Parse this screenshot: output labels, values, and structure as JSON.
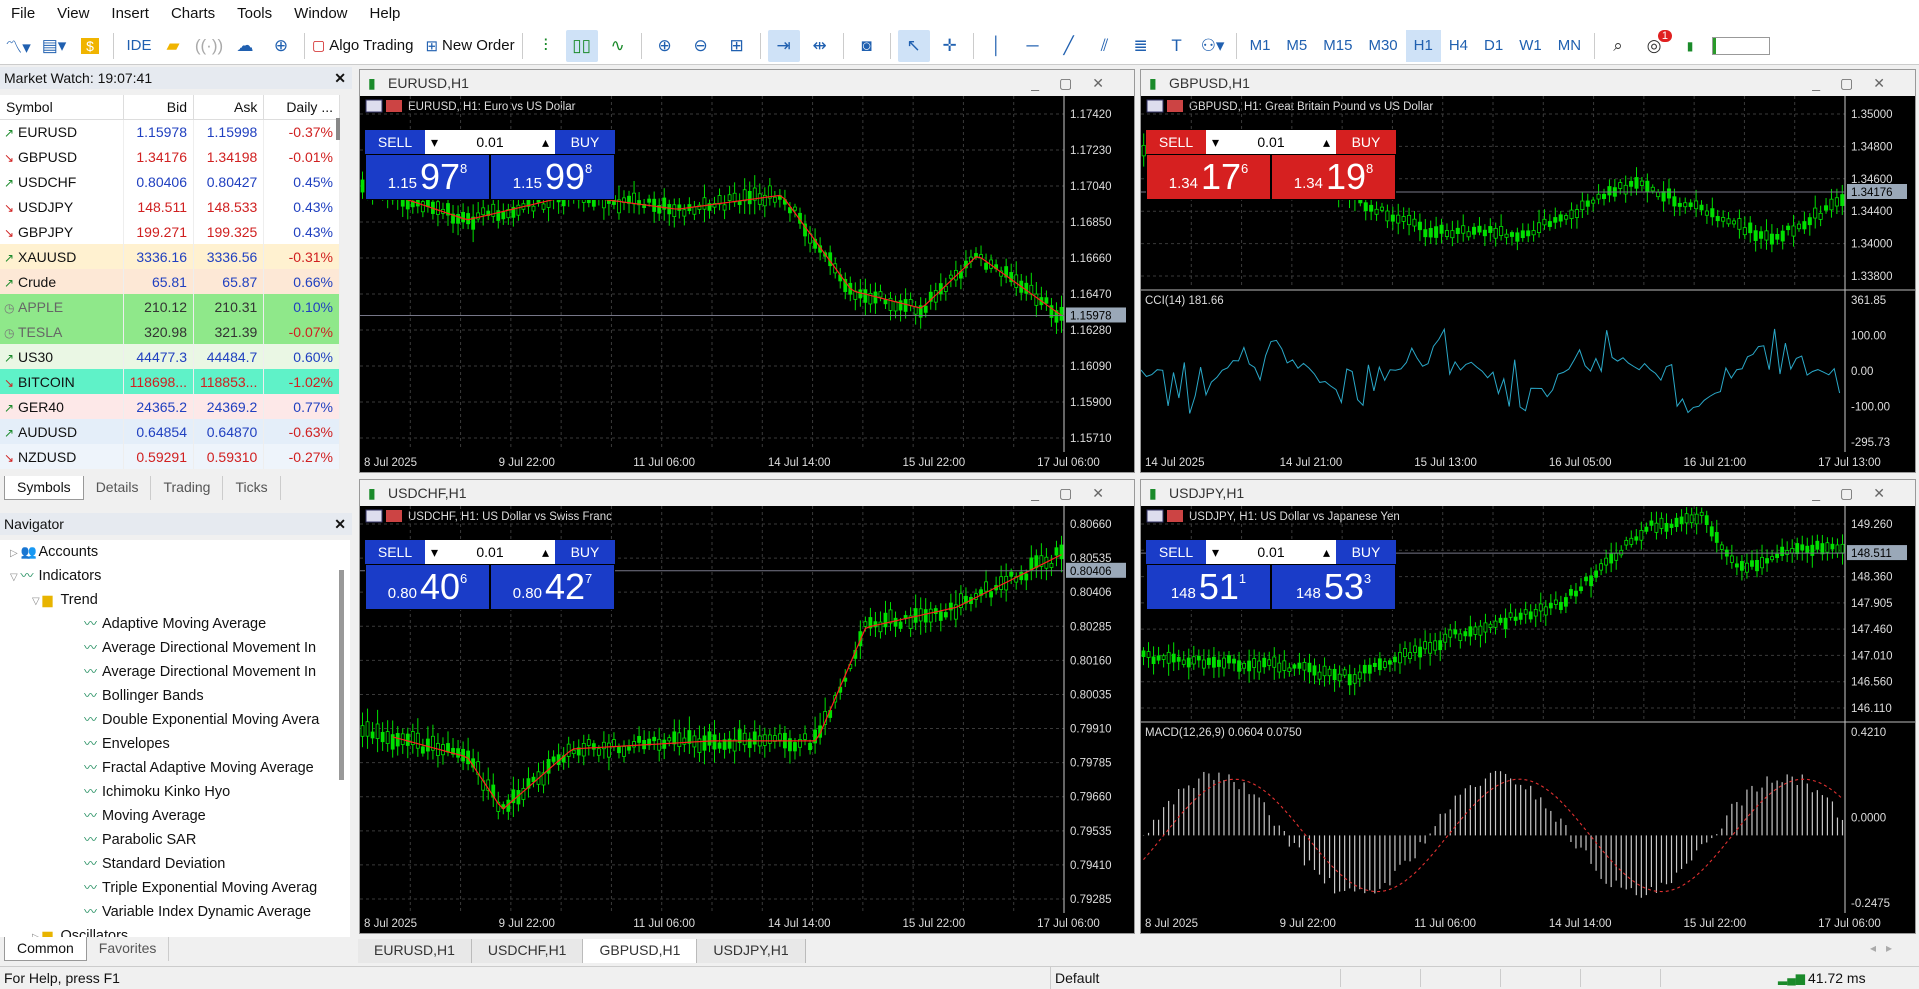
{
  "menu": [
    "File",
    "View",
    "Insert",
    "Charts",
    "Tools",
    "Window",
    "Help"
  ],
  "toolbar": {
    "ide": "IDE",
    "algo_trading": "Algo Trading",
    "new_order": "New Order",
    "timeframes": [
      "M1",
      "M5",
      "M15",
      "M30",
      "H1",
      "H4",
      "D1",
      "W1",
      "MN"
    ],
    "selected_timeframe": "H1",
    "notification_count": "1"
  },
  "market_watch": {
    "title": "Market Watch: 19:07:41",
    "columns": [
      "Symbol",
      "Bid",
      "Ask",
      "Daily ..."
    ],
    "rows": [
      {
        "symbol": "EURUSD",
        "bid": "1.15978",
        "ask": "1.15998",
        "daily": "-0.37%",
        "dir": "up",
        "bg": "#ffffff"
      },
      {
        "symbol": "GBPUSD",
        "bid": "1.34176",
        "ask": "1.34198",
        "daily": "-0.01%",
        "dir": "dn",
        "bg": "#ffffff"
      },
      {
        "symbol": "USDCHF",
        "bid": "0.80406",
        "ask": "0.80427",
        "daily": "0.45%",
        "dir": "up",
        "bg": "#ffffff"
      },
      {
        "symbol": "USDJPY",
        "bid": "148.511",
        "ask": "148.533",
        "daily": "0.43%",
        "dir": "dn",
        "bg": "#ffffff"
      },
      {
        "symbol": "GBPJPY",
        "bid": "199.271",
        "ask": "199.325",
        "daily": "0.43%",
        "dir": "dn",
        "bg": "#ffffff"
      },
      {
        "symbol": "XAUUSD",
        "bid": "3336.16",
        "ask": "3336.56",
        "daily": "-0.31%",
        "dir": "up",
        "bg": "#fff1d0"
      },
      {
        "symbol": "Crude",
        "bid": "65.81",
        "ask": "65.87",
        "daily": "0.66%",
        "dir": "up",
        "bg": "#fde8d6"
      },
      {
        "symbol": "APPLE",
        "bid": "210.12",
        "ask": "210.31",
        "daily": "0.10%",
        "dir": "clock",
        "bg": "#8fe88a"
      },
      {
        "symbol": "TESLA",
        "bid": "320.98",
        "ask": "321.39",
        "daily": "-0.07%",
        "dir": "clock",
        "bg": "#8fe88a"
      },
      {
        "symbol": "US30",
        "bid": "44477.3",
        "ask": "44484.7",
        "daily": "0.60%",
        "dir": "up",
        "bg": "#eaf7e4"
      },
      {
        "symbol": "BITCOIN",
        "bid": "118698...",
        "ask": "118853...",
        "daily": "-1.02%",
        "dir": "dn",
        "bg": "#5ff2c8"
      },
      {
        "symbol": "GER40",
        "bid": "24365.2",
        "ask": "24369.2",
        "daily": "0.77%",
        "dir": "up",
        "bg": "#fde8e8"
      },
      {
        "symbol": "AUDUSD",
        "bid": "0.64854",
        "ask": "0.64870",
        "daily": "-0.63%",
        "dir": "up",
        "bg": "#e4eef9"
      },
      {
        "symbol": "NZDUSD",
        "bid": "0.59291",
        "ask": "0.59310",
        "daily": "-0.27%",
        "dir": "dn",
        "bg": "#eef4fb"
      }
    ],
    "tabs": [
      "Symbols",
      "Details",
      "Trading",
      "Ticks"
    ],
    "active_tab": "Symbols"
  },
  "navigator": {
    "title": "Navigator",
    "accounts": "Accounts",
    "indicators": "Indicators",
    "trend": "Trend",
    "items": [
      "Adaptive Moving Average",
      "Average Directional Movement In",
      "Average Directional Movement In",
      "Bollinger Bands",
      "Double Exponential Moving Avera",
      "Envelopes",
      "Fractal Adaptive Moving Average",
      "Ichimoku Kinko Hyo",
      "Moving Average",
      "Parabolic SAR",
      "Standard Deviation",
      "Triple Exponential Moving Averag",
      "Variable Index Dynamic Average"
    ],
    "oscillators": "Oscillators",
    "tabs": [
      "Common",
      "Favorites"
    ]
  },
  "charts": [
    {
      "id": "eurusd",
      "window_title": "EURUSD,H1",
      "header": "EURUSD, H1:  Euro vs US Dollar",
      "theme": "blue",
      "sell_label": "SELL",
      "buy_label": "BUY",
      "lot": "0.01",
      "sell_price": {
        "big": "1.15",
        "main": "97",
        "small": "8"
      },
      "buy_price": {
        "big": "1.15",
        "main": "99",
        "small": "8"
      },
      "y_ticks": [
        "1.17420",
        "1.17230",
        "1.17040",
        "1.16850",
        "1.16660",
        "1.16470",
        "1.16280",
        "1.16090",
        "1.15900",
        "1.15710"
      ],
      "current_price": "1.15978",
      "x_ticks": [
        "8 Jul 2025",
        "9 Jul 22:00",
        "11 Jul 06:00",
        "14 Jul 14:00",
        "15 Jul 22:00",
        "17 Jul 06:00"
      ],
      "ma_color": "#ff2020"
    },
    {
      "id": "gbpusd",
      "window_title": "GBPUSD,H1",
      "header": "GBPUSD, H1:  Great Britain Pound vs US Dollar",
      "theme": "red",
      "sell_label": "SELL",
      "buy_label": "BUY",
      "lot": "0.01",
      "sell_price": {
        "big": "1.34",
        "main": "17",
        "small": "6"
      },
      "buy_price": {
        "big": "1.34",
        "main": "19",
        "small": "8"
      },
      "y_ticks": [
        "1.35000",
        "1.34800",
        "1.34600",
        "1.34400",
        "1.34000",
        "1.33800"
      ],
      "current_price": "1.34176",
      "indicator_label": "CCI(14) 181.66",
      "indicator_ticks": [
        "361.85",
        "100.00",
        "0.00",
        "-100.00",
        "-295.73"
      ],
      "x_ticks": [
        "14 Jul 2025",
        "14 Jul 21:00",
        "15 Jul 13:00",
        "16 Jul 05:00",
        "16 Jul 21:00",
        "17 Jul 13:00"
      ]
    },
    {
      "id": "usdchf",
      "window_title": "USDCHF,H1",
      "header": "USDCHF, H1:  US Dollar vs Swiss Franc",
      "theme": "blue",
      "sell_label": "SELL",
      "buy_label": "BUY",
      "lot": "0.01",
      "sell_price": {
        "big": "0.80",
        "main": "40",
        "small": "6"
      },
      "buy_price": {
        "big": "0.80",
        "main": "42",
        "small": "7"
      },
      "y_ticks": [
        "0.80660",
        "0.80535",
        "0.80406",
        "0.80285",
        "0.80160",
        "0.80035",
        "0.79910",
        "0.79785",
        "0.79660",
        "0.79535",
        "0.79410",
        "0.79285"
      ],
      "current_price": "0.80406",
      "x_ticks": [
        "8 Jul 2025",
        "9 Jul 22:00",
        "11 Jul 06:00",
        "14 Jul 14:00",
        "15 Jul 22:00",
        "17 Jul 06:00"
      ]
    },
    {
      "id": "usdjpy",
      "window_title": "USDJPY,H1",
      "header": "USDJPY, H1:  US Dollar vs Japanese Yen",
      "theme": "blue",
      "sell_label": "SELL",
      "buy_label": "BUY",
      "lot": "0.01",
      "sell_price": {
        "big": "148",
        "main": "51",
        "small": "1"
      },
      "buy_price": {
        "big": "148",
        "main": "53",
        "small": "3"
      },
      "y_ticks": [
        "149.260",
        "148.810",
        "148.360",
        "147.905",
        "147.460",
        "147.010",
        "146.560",
        "146.110"
      ],
      "current_price": "148.511",
      "indicator_label": "MACD(12,26,9) 0.0604 0.0750",
      "indicator_ticks": [
        "0.4210",
        "0.0000",
        "-0.2475"
      ],
      "x_ticks": [
        "8 Jul 2025",
        "9 Jul 22:00",
        "11 Jul 06:00",
        "14 Jul 14:00",
        "15 Jul 22:00",
        "17 Jul 06:00"
      ]
    }
  ],
  "bottom_tabs": [
    "EURUSD,H1",
    "USDCHF,H1",
    "GBPUSD,H1",
    "USDJPY,H1"
  ],
  "active_bottom_tab": "GBPUSD,H1",
  "status": {
    "help": "For Help, press F1",
    "profile": "Default",
    "ping": "41.72 ms"
  }
}
